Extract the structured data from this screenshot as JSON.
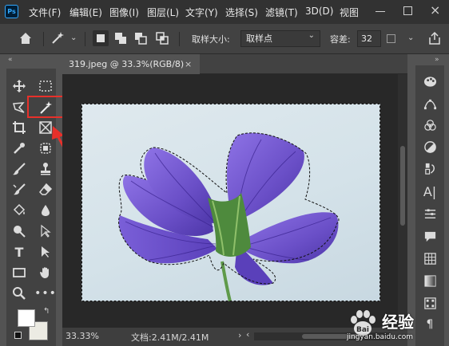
{
  "menubar": {
    "app_icon": "Ps",
    "items": [
      "文件(F)",
      "编辑(E)",
      "图像(I)",
      "图层(L)",
      "文字(Y)",
      "选择(S)",
      "滤镜(T)",
      "3D(D)",
      "视图"
    ]
  },
  "options": {
    "sample_size_label": "取样大小:",
    "sample_size_value": "取样点",
    "tolerance_label": "容差:",
    "tolerance_value": "32"
  },
  "document": {
    "tab_title": "319.jpeg @ 33.3%(RGB/8)",
    "close_symbol": "×"
  },
  "status": {
    "zoom": "33.33%",
    "doc_info": "文档:2.41M/2.41M"
  },
  "tools": [
    "move-icon",
    "marquee-icon",
    "lasso-icon",
    "magic-wand-icon",
    "crop-icon",
    "frame-icon",
    "eyedropper-icon",
    "patch-icon",
    "brush-icon",
    "stamp-icon",
    "history-brush-icon",
    "eraser-icon",
    "paint-bucket-icon",
    "blur-drop-icon",
    "dodge-icon",
    "path-select-icon",
    "type-icon",
    "direct-select-icon",
    "rectangle-icon",
    "hand-icon",
    "zoom-icon",
    "more-icon"
  ],
  "watermark": {
    "brand": "Bai",
    "name": "经验",
    "url": "jingyan.baidu.com"
  },
  "colors": {
    "highlight": "#e8302a",
    "arrow": "#e8302a",
    "petal": "#6a4fc7"
  }
}
